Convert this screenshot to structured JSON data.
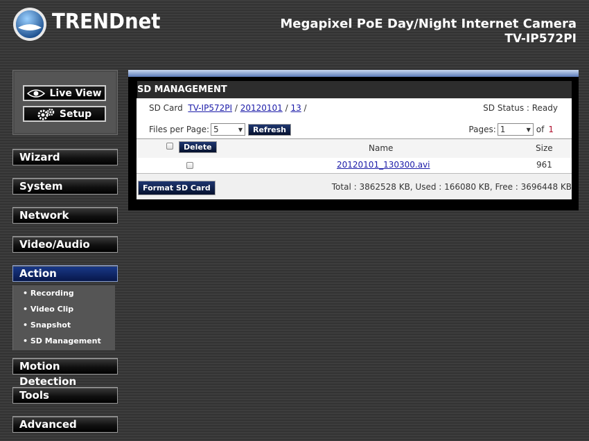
{
  "header": {
    "brand": "TRENDnet",
    "product_title": "Megapixel PoE Day/Night Internet Camera",
    "model": "TV-IP572PI"
  },
  "top_buttons": {
    "live_view": "Live View",
    "setup": "Setup"
  },
  "nav": {
    "wizard": "Wizard",
    "system": "System",
    "network": "Network",
    "video_audio": "Video/Audio",
    "action": "Action",
    "motion_detection": "Motion Detection",
    "tools": "Tools",
    "advanced": "Advanced"
  },
  "action_submenu": [
    "Recording",
    "Video Clip",
    "Snapshot",
    "SD Management"
  ],
  "panel": {
    "title": "SD MANAGEMENT",
    "path_label": "SD Card",
    "path_parts": [
      "TV-IP572PI",
      "20120101",
      "13"
    ],
    "sd_status_label": "SD Status : Ready",
    "files_per_page_label": "Files per Page:",
    "files_per_page_value": "5",
    "refresh_label": "Refresh",
    "pages_label": "Pages:",
    "pages_value": "1",
    "of_label": "of",
    "pages_total": "1",
    "delete_label": "Delete",
    "col_name": "Name",
    "col_size": "Size",
    "files": [
      {
        "name": "20120101_130300.avi",
        "size": "961"
      }
    ],
    "format_label": "Format SD Card",
    "totals": "Total :  3862528 KB,  Used :  166080 KB,  Free : 3696448 KB"
  }
}
